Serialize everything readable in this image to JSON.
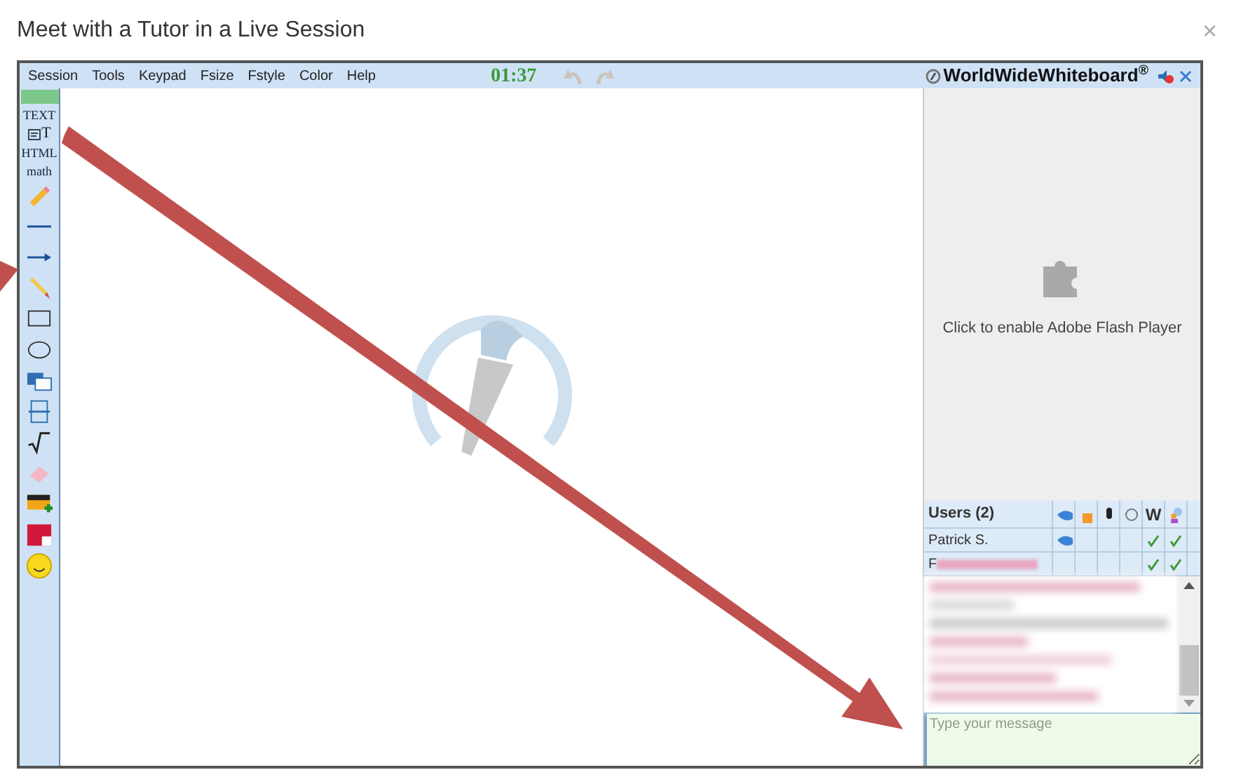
{
  "dialog": {
    "title": "Meet with a Tutor in a Live Session",
    "close": "×"
  },
  "menu": [
    "Session",
    "Tools",
    "Keypad",
    "Fsize",
    "Fstyle",
    "Color",
    "Help"
  ],
  "timer": "01:37",
  "undo_enabled": false,
  "brand": "WorldWideWhiteboard",
  "brand_mark": "®",
  "tools": [
    {
      "kind": "swatch"
    },
    {
      "kind": "label",
      "label": "TEXT"
    },
    {
      "kind": "textbox",
      "label": "T"
    },
    {
      "kind": "label",
      "label": "HTML"
    },
    {
      "kind": "label",
      "label": "math"
    },
    {
      "kind": "pencil"
    },
    {
      "kind": "line"
    },
    {
      "kind": "arrow"
    },
    {
      "kind": "highlighter"
    },
    {
      "kind": "rect"
    },
    {
      "kind": "ellipse"
    },
    {
      "kind": "copy"
    },
    {
      "kind": "split"
    },
    {
      "kind": "root"
    },
    {
      "kind": "eraser"
    },
    {
      "kind": "image"
    },
    {
      "kind": "color"
    },
    {
      "kind": "smiley"
    }
  ],
  "flash_message": "Click to enable Adobe Flash Player",
  "users": {
    "title": "Users (2)",
    "w_heading": "W",
    "rows": [
      {
        "name": "Patrick S.",
        "redacted": false,
        "pointer": true,
        "whiteboard": true,
        "chat": true
      },
      {
        "name": "F",
        "redacted": true,
        "pointer": false,
        "whiteboard": true,
        "chat": true
      }
    ]
  },
  "chat": {
    "redacted": true
  },
  "message_field": {
    "placeholder": "Type your message"
  }
}
